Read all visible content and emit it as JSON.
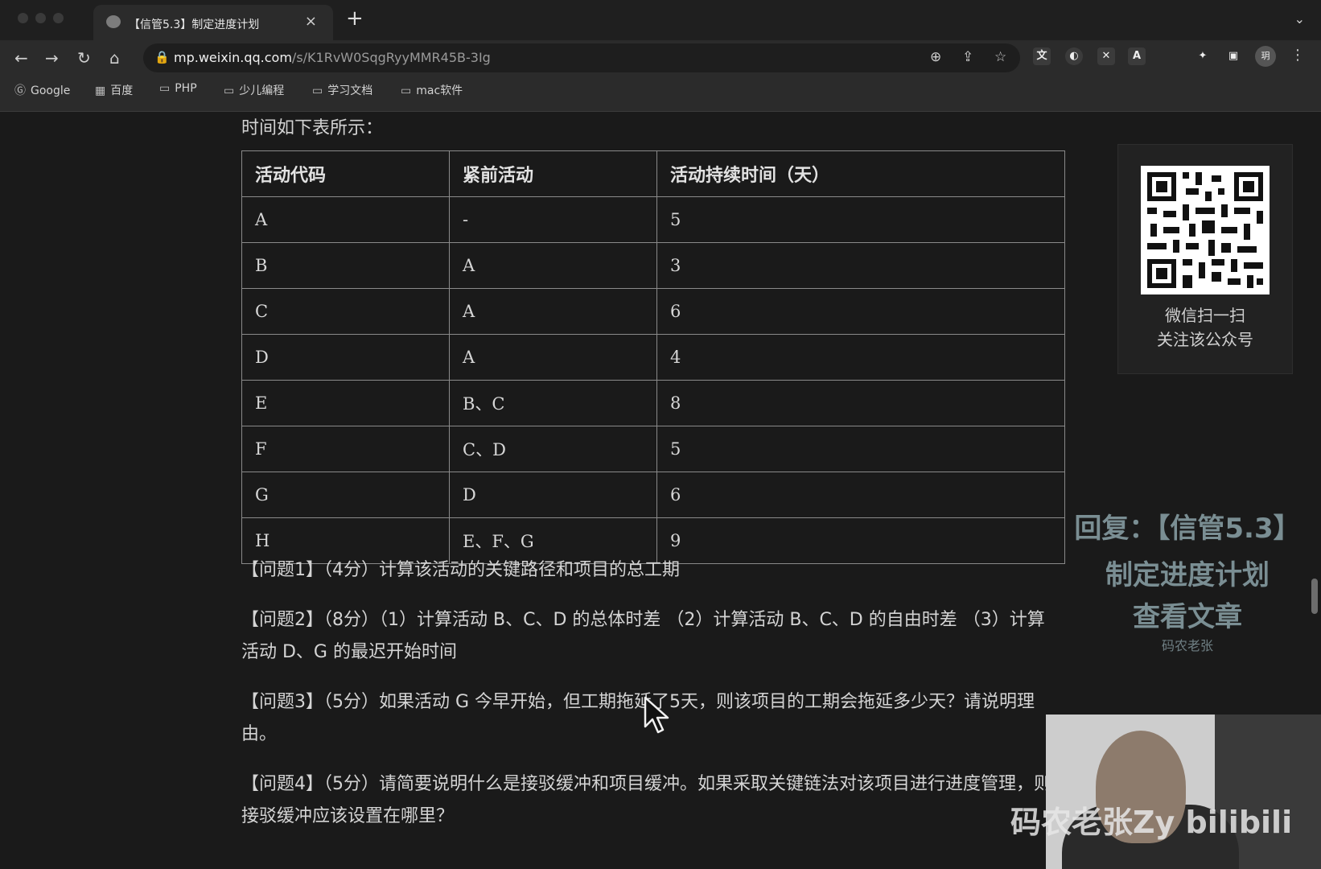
{
  "browser": {
    "tab_title": "【信管5.3】制定进度计划",
    "tab_close": "×",
    "new_tab": "+",
    "url_host": "mp.weixin.qq.com",
    "url_path": "/s/K1RvW0SqgRyyMMR45B-3Ig",
    "avatar_text": "玥",
    "bookmarks": [
      "Google",
      "百度",
      "PHP",
      "少儿编程",
      "学习文档",
      "mac软件"
    ]
  },
  "article": {
    "intro": "时间如下表所示：",
    "table": {
      "headers": [
        "活动代码",
        "紧前活动",
        "活动持续时间（天）"
      ],
      "rows": [
        [
          "A",
          "-",
          "5"
        ],
        [
          "B",
          "A",
          "3"
        ],
        [
          "C",
          "A",
          "6"
        ],
        [
          "D",
          "A",
          "4"
        ],
        [
          "E",
          "B、C",
          "8"
        ],
        [
          "F",
          "C、D",
          "5"
        ],
        [
          "G",
          "D",
          "6"
        ],
        [
          "H",
          "E、F、G",
          "9"
        ]
      ]
    },
    "questions": [
      "【问题1】（4分）计算该活动的关键路径和项目的总工期",
      "【问题2】（8分）（1）计算活动 B、C、D 的总体时差 （2）计算活动 B、C、D 的自由时差 （3）计算活动 D、G 的最迟开始时间",
      "【问题3】（5分）如果活动 G 今早开始，但工期拖延了5天，则该项目的工期会拖延多少天？请说明理由。",
      "【问题4】（5分）请简要说明什么是接驳缓冲和项目缓冲。如果采取关键链法对该项目进行进度管理，则接驳缓冲应该设置在哪里？"
    ]
  },
  "sidebar": {
    "qr_line1": "微信扫一扫",
    "qr_line2": "关注该公众号"
  },
  "overlay": {
    "line1": "回复：【信管5.3】",
    "line2": "制定进度计划",
    "line3": "查看文章",
    "line4": "码农老张"
  },
  "webcam": {
    "watermark": "码农老张Zy bilibili"
  },
  "colors": {
    "page_bg": "#1a1a1a",
    "chrome_bg": "#2b2b2b",
    "overlay_text": "#7a8e93"
  }
}
